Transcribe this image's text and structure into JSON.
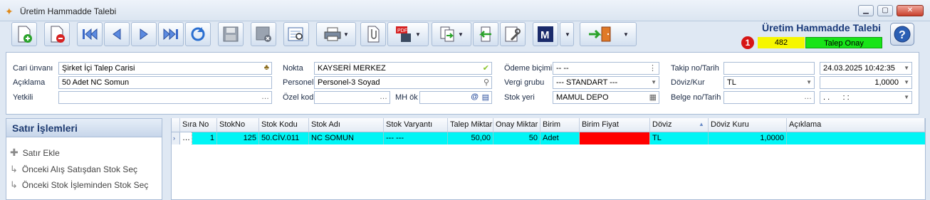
{
  "window": {
    "title": "Üretim Hammadde Talebi",
    "min": "▁",
    "max": "▢",
    "close": "✕"
  },
  "header": {
    "title": "Üretim Hammadde Talebi",
    "badge_number": "1",
    "doc_no": "482",
    "status": "Talep Onay"
  },
  "form": {
    "cari_unvani_label": "Cari ünvanı",
    "cari_unvani": "Şirket İçi Talep Carisi",
    "aciklama_label": "Açıklama",
    "aciklama": "50 Adet NC Somun",
    "yetkili_label": "Yetkili",
    "yetkili": "",
    "nokta_label": "Nokta",
    "nokta": "KAYSERİ MERKEZ",
    "personel_label": "Personel",
    "personel": "Personel-3 Soyad",
    "ozel_kod_label": "Özel kod",
    "ozel_kod": "",
    "mh_ok_label": "MH ök",
    "mh_ok": "",
    "odeme_bicimi_label": "Ödeme biçimi",
    "odeme_bicimi": "-- --",
    "vergi_grubu_label": "Vergi grubu",
    "vergi_grubu": "--- STANDART ---",
    "stok_yeri_label": "Stok yeri",
    "stok_yeri": "MAMUL DEPO",
    "takip_label": "Takip no/Tarih",
    "takip_no": "",
    "takip_tarih": "24.03.2025 10:42:35",
    "doviz_label": "Döviz/Kur",
    "doviz": "TL",
    "kur": "1,0000",
    "belge_label": "Belge no/Tarih",
    "belge_no": "",
    "belge_tarih": ". .      : :"
  },
  "side": {
    "title": "Satır İşlemleri",
    "items": [
      "Satır Ekle",
      "Önceki Alış Satışdan Stok Seç",
      "Önceki Stok İşleminden Stok Seç"
    ]
  },
  "grid": {
    "headers": [
      "Sıra No",
      "StokNo",
      "Stok Kodu",
      "Stok Adı",
      "Stok Varyantı",
      "Talep Miktar",
      "Onay Miktar",
      "Birim",
      "Birim Fiyat",
      "Döviz",
      "Döviz Kuru",
      "Açıklama"
    ],
    "row": {
      "sira": "1",
      "stokno": "125",
      "kod": "50.CİV.011",
      "ad": "NC SOMUN",
      "varyant": "--- ---",
      "talep": "50,00",
      "onay": "50",
      "birim": "Adet",
      "fiyat": "",
      "doviz": "TL",
      "kur": "1,0000",
      "aciklama": ""
    }
  },
  "colors": {
    "accent": "#1a3a7a",
    "row_highlight": "#00f5f5",
    "price_cell": "#ff0000",
    "status_green": "#18e418",
    "doc_yellow": "#f6f600"
  }
}
